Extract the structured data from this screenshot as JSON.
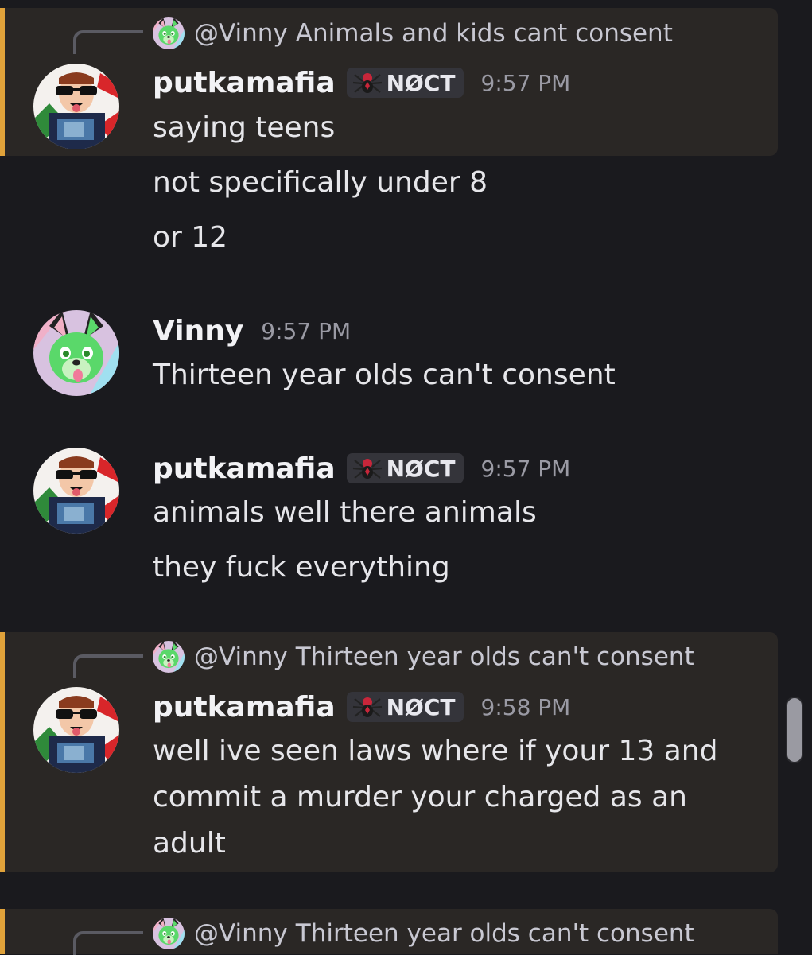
{
  "tag_text": "NØCT",
  "reply_mention": "@Vinny",
  "icons": {
    "user_avatar": "sunglasses-character-avatar-icon",
    "vinny_avatar": "green-wolf-avatar-icon",
    "tag_icon": "red-spider-icon",
    "reply_avatar": "green-wolf-avatar-icon"
  },
  "colors": {
    "background": "#1a1a1e",
    "highlight_bg": "#2a2725",
    "highlight_bar": "#e0a23a",
    "timestamp": "#9a9aa4"
  },
  "messages": [
    {
      "reply_text": "Animals and kids cant consent",
      "username": "putkamafia",
      "time": "9:57 PM",
      "lines": [
        "saying teens",
        "not specifically under 8",
        "or 12"
      ]
    },
    {
      "username": "Vinny",
      "time": "9:57 PM",
      "lines": [
        "Thirteen year olds can't consent"
      ]
    },
    {
      "username": "putkamafia",
      "time": "9:57 PM",
      "lines": [
        "animals well there animals",
        "they fuck everything"
      ]
    },
    {
      "reply_text": "Thirteen year olds can't consent",
      "username": "putkamafia",
      "time": "9:58 PM",
      "lines": [
        "well ive seen laws where if your 13 and",
        "commit a murder your charged as an",
        "adult"
      ]
    },
    {
      "reply_text": "Thirteen year olds can't consent"
    }
  ]
}
